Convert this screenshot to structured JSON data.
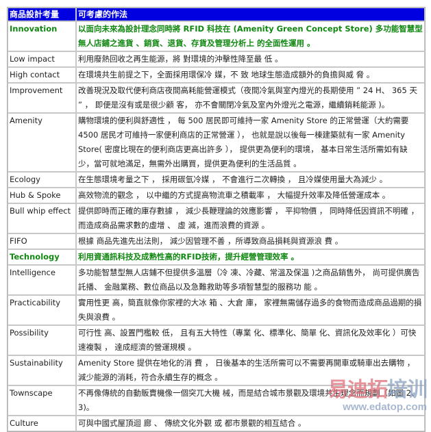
{
  "header": {
    "col1": "商品設計考量",
    "col2": "可考慮的作法"
  },
  "rows": [
    {
      "key": "Innovation",
      "text": "以面向未來為設計理念同時將 RFID 科技在 (Amenity Green Concept Store) 多功能智慧型無人店鋪之進貨 、銷貨、退貨、存貨及管理分析上 的全面性運用 。",
      "highlight": true
    },
    {
      "key": "Low impact",
      "text": "利用廢熱回收之再生能源，將 對環境的沖擊性降至最 低 。"
    },
    {
      "key": "High contact",
      "text": "在環境共生前提之下，全面採用環保冷 媒，不 致 地球生態造成額外的負擔與威 脅 。"
    },
    {
      "key": "Improvement",
      "text": "改善現況及取代便利商店夜間高耗能營運模式（夜間冷氣與室內燈光的長期使用 ” 24 H、 365 天 ” ， 即便是沒有或是很少顧 客， 亦不會關閉冷氣及室內外燈光之電源，繼續銷耗能源 )。"
    },
    {
      "key": "Amenity",
      "text": "購物環境的便利與舒適性 ， 每 500 居民即可維持一家 Amenity Store 的正常營運（大約需要4500 居民才可維持一家便利商店的正常營運 ）， 也就是說以後每一棟建築就有一家 Amenity Store( 密度比現在的便利商店更高出許多 ）， 提供更為便利的環境， 基本日常生活所需如有缺少，當可就地滿足，無需外出購買，提供更為便利的生活品質 。"
    },
    {
      "key": "Ecology",
      "text": "在生態環境考量之下 ， 採用碳氫冷媒 ， 不會進行二次轉換 ， 且冷媒使用量大為減少 。"
    },
    {
      "key": "Hub & Spoke",
      "text": "高效物流的觀念 ， 以中繼的方式提高物流車之積載率 ， 大幅提升效率及降低營運成本 。"
    },
    {
      "key": "Bull whip effect",
      "text": "提供即時而正確的庫存數據 ， 減少長鞭理論的效應影響 ， 平抑物價 ， 同時降低因資訊不明確 ，而造成商品需求數的虛增 、 虛 減，進而浪費的資源 。"
    },
    {
      "key": "FIFO",
      "text": "根據 商品先進先出法則， 減少因管理不善 ，所導致商品損耗與資源浪 費 。"
    },
    {
      "key": "Technology",
      "text": "利用資通訊科技及成熟性高的RFID技術，提升經營管理效率 。",
      "highlight": true
    },
    {
      "key": "Intelligence",
      "text": "多功能智慧型無人店鋪不但提供多溫層（冷 凍、冷藏、常溫及保溫 )之商品銷售外， 尚可提供廣告託播、 金融業務、數位商品以及急難救助等多項智慧型的服務功 能 。"
    },
    {
      "key": "Practicability",
      "text": "實用性更 高，簡直就像你家裡的大冰 箱 、大倉 庫， 家裡無需儲存過多的食物而造成商品過期的損失與浪費 。"
    },
    {
      "key": "Possibility",
      "text": "可行性 高、設置門檻較 低， 且有五大特性（專業 化、標準化、簡單 化、資訊化及效率化 ）可快速複製 ， 達成經濟的營運規模 。"
    },
    {
      "key": "Sustainability",
      "text": "Amenity Store 提供在地化的消 費 ， 日後基本的生活所需可以不需要再開車或騎車出去購物 ， 減少能源的消耗，符合永續生存的概念 。"
    },
    {
      "key": "Townscape",
      "text": "不再像傳統的自動販賣機像一個突兀大機 械，而是結合城市景觀及環境共生理念而規劃（如圖 2、 3)。"
    },
    {
      "key": "Culture",
      "text": "可與中國式屋頂迴 廊 、 傳統文化外觀 或 都市景觀的相互結合 。"
    }
  ],
  "watermark": {
    "cn": "易迪拓培训",
    "url": "www.edatop.com"
  },
  "colors": {
    "header_bg": "#0000e0",
    "highlight_text": "#118811"
  }
}
